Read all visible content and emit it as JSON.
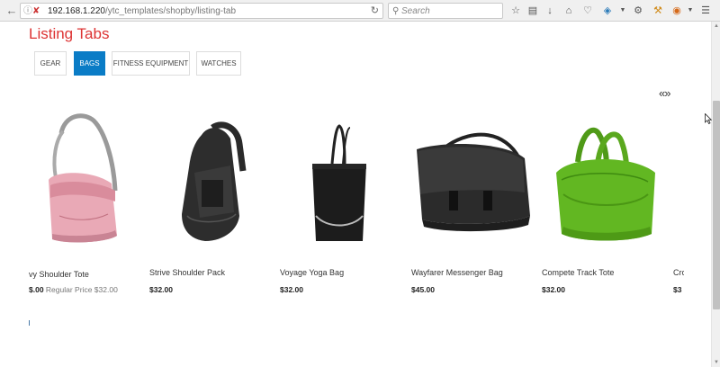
{
  "browser": {
    "url_host": "192.168.1.220",
    "url_path": "/ytc_templates/shopby/listing-tab",
    "search_placeholder": "Search"
  },
  "page": {
    "title": "Listing Tabs"
  },
  "tabs": [
    {
      "label": "GEAR",
      "active": false
    },
    {
      "label": "BAGS",
      "active": true
    },
    {
      "label": "FITNESS EQUIPMENT",
      "active": false
    },
    {
      "label": "WATCHES",
      "active": false
    }
  ],
  "carousel": {
    "arrows": "«»"
  },
  "products": [
    {
      "name": "vy Shoulder Tote",
      "price": "$.00",
      "regular_label": "Regular Price",
      "regular_price": "$32.00",
      "image": "pink-shoulder-tote"
    },
    {
      "name": "Strive Shoulder Pack",
      "price": "$32.00",
      "image": "black-sling-backpack"
    },
    {
      "name": "Voyage Yoga Bag",
      "price": "$32.00",
      "image": "black-tote-bag"
    },
    {
      "name": "Wayfarer Messenger Bag",
      "price": "$45.00",
      "image": "black-messenger-bag"
    },
    {
      "name": "Compete Track Tote",
      "price": "$32.00",
      "image": "green-track-tote"
    },
    {
      "name": "Cro",
      "price": "$3",
      "image": ""
    }
  ],
  "colors": {
    "title_red": "#dd3333",
    "tab_active_blue": "#0a7cc6"
  }
}
